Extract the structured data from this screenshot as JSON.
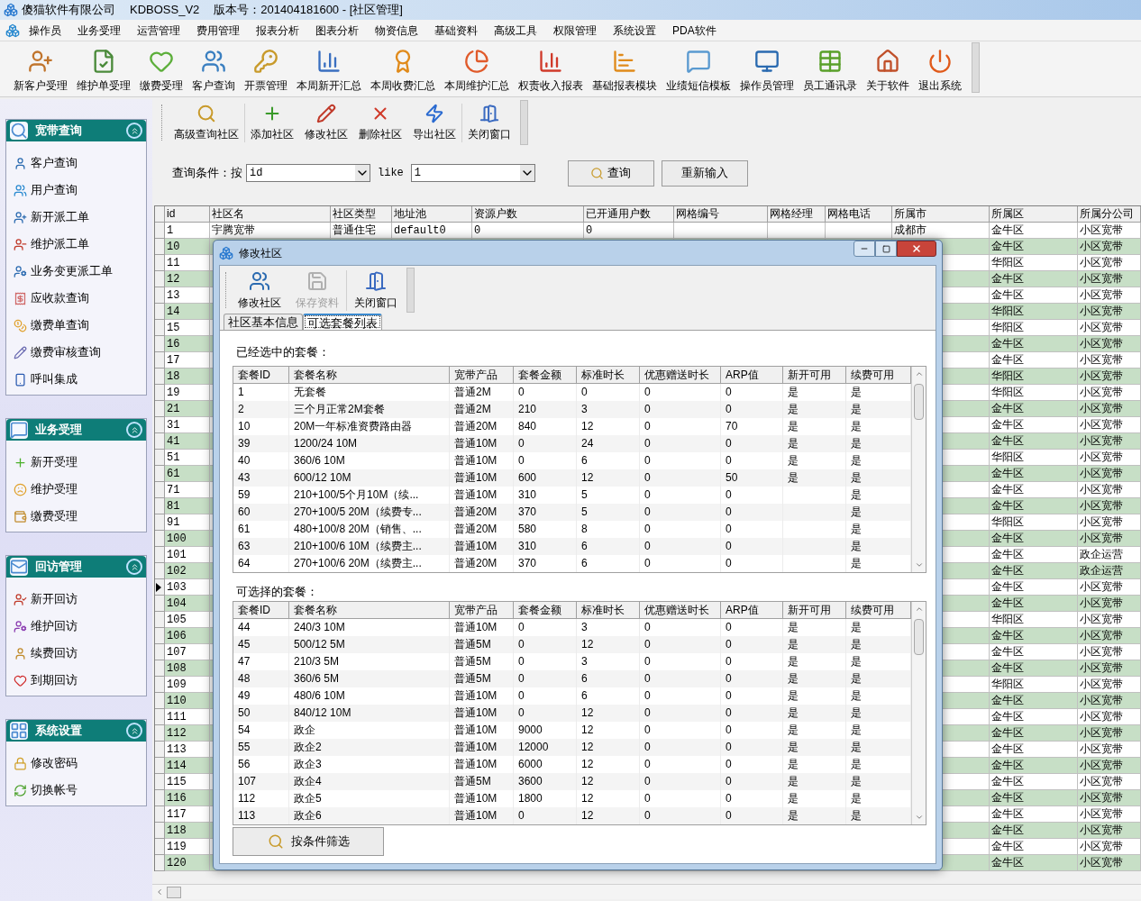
{
  "window": {
    "company": "傻猫软件有限公司",
    "app": "KDBOSS_V2",
    "version": "版本号：201404181600 - [社区管理]"
  },
  "menu": [
    "操作员",
    "业务受理",
    "运营管理",
    "费用管理",
    "报表分析",
    "图表分析",
    "物资信息",
    "基础资料",
    "高级工具",
    "权限管理",
    "系统设置",
    "PDA软件"
  ],
  "toolbar": [
    "新客户受理",
    "维护单受理",
    "缴费受理",
    "客户查询",
    "开票管理",
    "本周新开汇总",
    "本周收费汇总",
    "本周维护汇总",
    "权责收入报表",
    "基础报表模块",
    "业绩短信模板",
    "操作员管理",
    "员工通讯录",
    "关于软件",
    "退出系统"
  ],
  "sidebar": [
    {
      "title": "宽带查询",
      "expanded": true,
      "items": [
        "客户查询",
        "用户查询",
        "新开派工单",
        "维护派工单",
        "业务变更派工单",
        "应收款查询",
        "缴费单查询",
        "缴费审核查询",
        "呼叫集成"
      ]
    },
    {
      "title": "业务受理",
      "expanded": true,
      "items": [
        "新开受理",
        "维护受理",
        "缴费受理"
      ]
    },
    {
      "title": "回访管理",
      "expanded": true,
      "items": [
        "新开回访",
        "维护回访",
        "续费回访",
        "到期回访"
      ]
    },
    {
      "title": "系统设置",
      "expanded": true,
      "items": [
        "修改密码",
        "切换帐号"
      ]
    }
  ],
  "sub_toolbar": [
    "高级查询社区",
    "添加社区",
    "修改社区",
    "删除社区",
    "导出社区",
    "关闭窗口"
  ],
  "query": {
    "label": "查询条件：按",
    "field": "id",
    "operator": "like",
    "value": "1",
    "buttons": [
      "查询",
      "重新输入"
    ]
  },
  "table": {
    "columns": [
      "id",
      "社区名",
      "社区类型",
      "地址池",
      "资源户数",
      "已开通用户数",
      "网格编号",
      "网格经理",
      "网格电话",
      "所属市",
      "所属区",
      "所属分公司"
    ],
    "rows": [
      {
        "id": "1",
        "name": "宇腾宽带",
        "type": "普通住宅",
        "pool": "default0",
        "resources": "0",
        "opened": "0",
        "city": "成都市",
        "district": "金牛区",
        "company": "小区宽带",
        "selected": false
      },
      {
        "id": "10",
        "district": "金牛区",
        "company": "小区宽带",
        "selected": false
      },
      {
        "id": "11",
        "district": "华阳区",
        "company": "小区宽带",
        "selected": false
      },
      {
        "id": "12",
        "district": "金牛区",
        "company": "小区宽带",
        "selected": false
      },
      {
        "id": "13",
        "district": "金牛区",
        "company": "小区宽带",
        "selected": false
      },
      {
        "id": "14",
        "district": "华阳区",
        "company": "小区宽带",
        "selected": false
      },
      {
        "id": "15",
        "district": "华阳区",
        "company": "小区宽带",
        "selected": false
      },
      {
        "id": "16",
        "district": "金牛区",
        "company": "小区宽带",
        "selected": false
      },
      {
        "id": "17",
        "district": "金牛区",
        "company": "小区宽带",
        "selected": false
      },
      {
        "id": "18",
        "district": "华阳区",
        "company": "小区宽带",
        "selected": false
      },
      {
        "id": "19",
        "district": "华阳区",
        "company": "小区宽带",
        "selected": false
      },
      {
        "id": "21",
        "district": "金牛区",
        "company": "小区宽带",
        "selected": false
      },
      {
        "id": "31",
        "district": "金牛区",
        "company": "小区宽带",
        "selected": false
      },
      {
        "id": "41",
        "district": "金牛区",
        "company": "小区宽带",
        "selected": false
      },
      {
        "id": "51",
        "district": "华阳区",
        "company": "小区宽带",
        "selected": false
      },
      {
        "id": "61",
        "district": "金牛区",
        "company": "小区宽带",
        "selected": false
      },
      {
        "id": "71",
        "district": "金牛区",
        "company": "小区宽带",
        "selected": false
      },
      {
        "id": "81",
        "district": "金牛区",
        "company": "小区宽带",
        "selected": false
      },
      {
        "id": "91",
        "district": "华阳区",
        "company": "小区宽带",
        "selected": false
      },
      {
        "id": "100",
        "district": "金牛区",
        "company": "小区宽带",
        "selected": false
      },
      {
        "id": "101",
        "district": "金牛区",
        "company": "政企运营",
        "selected": false
      },
      {
        "id": "102",
        "district": "金牛区",
        "company": "政企运营",
        "selected": false
      },
      {
        "id": "103",
        "district": "金牛区",
        "company": "小区宽带",
        "selected": true
      },
      {
        "id": "104",
        "district": "金牛区",
        "company": "小区宽带",
        "selected": false
      },
      {
        "id": "105",
        "district": "华阳区",
        "company": "小区宽带",
        "selected": false
      },
      {
        "id": "106",
        "district": "金牛区",
        "company": "小区宽带",
        "selected": false
      },
      {
        "id": "107",
        "district": "金牛区",
        "company": "小区宽带",
        "selected": false
      },
      {
        "id": "108",
        "district": "金牛区",
        "company": "小区宽带",
        "selected": false
      },
      {
        "id": "109",
        "district": "华阳区",
        "company": "小区宽带",
        "selected": false
      },
      {
        "id": "110",
        "district": "金牛区",
        "company": "小区宽带",
        "selected": false
      },
      {
        "id": "111",
        "district": "金牛区",
        "company": "小区宽带",
        "selected": false
      },
      {
        "id": "112",
        "district": "金牛区",
        "company": "小区宽带",
        "selected": false
      },
      {
        "id": "113",
        "district": "金牛区",
        "company": "小区宽带",
        "selected": false
      },
      {
        "id": "114",
        "district": "金牛区",
        "company": "小区宽带",
        "selected": false
      },
      {
        "id": "115",
        "district": "金牛区",
        "company": "小区宽带",
        "selected": false
      },
      {
        "id": "116",
        "district": "金牛区",
        "company": "小区宽带",
        "selected": false
      },
      {
        "id": "117",
        "district": "金牛区",
        "company": "小区宽带",
        "selected": false
      },
      {
        "id": "118",
        "district": "金牛区",
        "company": "小区宽带",
        "selected": false
      },
      {
        "id": "119",
        "district": "金牛区",
        "company": "小区宽带",
        "selected": false
      },
      {
        "id": "120",
        "district": "金牛区",
        "company": "小区宽带",
        "selected": false
      }
    ]
  },
  "dialog": {
    "title": "修改社区",
    "toolbar": [
      {
        "label": "修改社区",
        "disabled": false
      },
      {
        "label": "保存资料",
        "disabled": true
      },
      {
        "label": "关闭窗口",
        "disabled": false
      }
    ],
    "tabs": [
      {
        "label": "社区基本信息",
        "selected": false
      },
      {
        "label": "可选套餐列表",
        "selected": true
      }
    ],
    "columns": [
      "套餐ID",
      "套餐名称",
      "宽带产品",
      "套餐金额",
      "标准时长",
      "优惠赠送时长",
      "ARP值",
      "新开可用",
      "续费可用"
    ],
    "selected_label": "已经选中的套餐：",
    "selected_packages": [
      {
        "id": "1",
        "name": "无套餐",
        "product": "普通2M",
        "amount": "0",
        "duration": "0",
        "bonus": "0",
        "arp": "0",
        "new": "是",
        "renew": "是"
      },
      {
        "id": "2",
        "name": "三个月正常2M套餐",
        "product": "普通2M",
        "amount": "210",
        "duration": "3",
        "bonus": "0",
        "arp": "0",
        "new": "是",
        "renew": "是"
      },
      {
        "id": "10",
        "name": "20M一年标准资费路由器",
        "product": "普通20M",
        "amount": "840",
        "duration": "12",
        "bonus": "0",
        "arp": "70",
        "new": "是",
        "renew": "是"
      },
      {
        "id": "39",
        "name": "1200/24  10M",
        "product": "普通10M",
        "amount": "0",
        "duration": "24",
        "bonus": "0",
        "arp": "0",
        "new": "是",
        "renew": "是"
      },
      {
        "id": "40",
        "name": "360/6  10M",
        "product": "普通10M",
        "amount": "0",
        "duration": "6",
        "bonus": "0",
        "arp": "0",
        "new": "是",
        "renew": "是"
      },
      {
        "id": "43",
        "name": "600/12  10M",
        "product": "普通10M",
        "amount": "600",
        "duration": "12",
        "bonus": "0",
        "arp": "50",
        "new": "是",
        "renew": "是"
      },
      {
        "id": "59",
        "name": "210+100/5个月10M（续...",
        "product": "普通10M",
        "amount": "310",
        "duration": "5",
        "bonus": "0",
        "arp": "0",
        "renew": "是"
      },
      {
        "id": "60",
        "name": "270+100/5 20M（续费专...",
        "product": "普通20M",
        "amount": "370",
        "duration": "5",
        "bonus": "0",
        "arp": "0",
        "renew": "是"
      },
      {
        "id": "61",
        "name": "480+100/8 20M（销售、...",
        "product": "普通20M",
        "amount": "580",
        "duration": "8",
        "bonus": "0",
        "arp": "0",
        "renew": "是"
      },
      {
        "id": "63",
        "name": "210+100/6 10M（续费主...",
        "product": "普通10M",
        "amount": "310",
        "duration": "6",
        "bonus": "0",
        "arp": "0",
        "renew": "是"
      },
      {
        "id": "64",
        "name": "270+100/6 20M（续费主...",
        "product": "普通20M",
        "amount": "370",
        "duration": "6",
        "bonus": "0",
        "arp": "0",
        "renew": "是"
      }
    ],
    "available_label": "可选择的套餐：",
    "available_columns": [
      "套餐ID",
      "套餐名称",
      "宽带产品",
      "套餐金额",
      "标准时长",
      "优惠赠送时长",
      "ARP值",
      "新开可用",
      "续费可用"
    ],
    "available_packages": [
      {
        "id": "44",
        "name": "240/3 10M",
        "product": "普通10M",
        "amount": "0",
        "duration": "3",
        "bonus": "0",
        "arp": "0",
        "new": "是",
        "renew": "是"
      },
      {
        "id": "45",
        "name": "500/12 5M",
        "product": "普通5M",
        "amount": "0",
        "duration": "12",
        "bonus": "0",
        "arp": "0",
        "new": "是",
        "renew": "是"
      },
      {
        "id": "47",
        "name": "210/3 5M",
        "product": "普通5M",
        "amount": "0",
        "duration": "3",
        "bonus": "0",
        "arp": "0",
        "new": "是",
        "renew": "是"
      },
      {
        "id": "48",
        "name": "360/6 5M",
        "product": "普通5M",
        "amount": "0",
        "duration": "6",
        "bonus": "0",
        "arp": "0",
        "new": "是",
        "renew": "是"
      },
      {
        "id": "49",
        "name": "480/6 10M",
        "product": "普通10M",
        "amount": "0",
        "duration": "6",
        "bonus": "0",
        "arp": "0",
        "new": "是",
        "renew": "是"
      },
      {
        "id": "50",
        "name": "840/12 10M",
        "product": "普通10M",
        "amount": "0",
        "duration": "12",
        "bonus": "0",
        "arp": "0",
        "new": "是",
        "renew": "是"
      },
      {
        "id": "54",
        "name": "政企",
        "product": "普通10M",
        "amount": "9000",
        "duration": "12",
        "bonus": "0",
        "arp": "0",
        "new": "是",
        "renew": "是"
      },
      {
        "id": "55",
        "name": "政企2",
        "product": "普通10M",
        "amount": "12000",
        "duration": "12",
        "bonus": "0",
        "arp": "0",
        "new": "是",
        "renew": "是"
      },
      {
        "id": "56",
        "name": "政企3",
        "product": "普通10M",
        "amount": "6000",
        "duration": "12",
        "bonus": "0",
        "arp": "0",
        "new": "是",
        "renew": "是"
      },
      {
        "id": "107",
        "name": "政企4",
        "product": "普通5M",
        "amount": "3600",
        "duration": "12",
        "bonus": "0",
        "arp": "0",
        "new": "是",
        "renew": "是"
      },
      {
        "id": "112",
        "name": "政企5",
        "product": "普通10M",
        "amount": "1800",
        "duration": "12",
        "bonus": "0",
        "arp": "0",
        "new": "是",
        "renew": "是"
      },
      {
        "id": "113",
        "name": "政企6",
        "product": "普通10M",
        "amount": "0",
        "duration": "12",
        "bonus": "0",
        "arp": "0",
        "new": "是",
        "renew": "是"
      }
    ],
    "filter_button": "按条件筛选"
  }
}
